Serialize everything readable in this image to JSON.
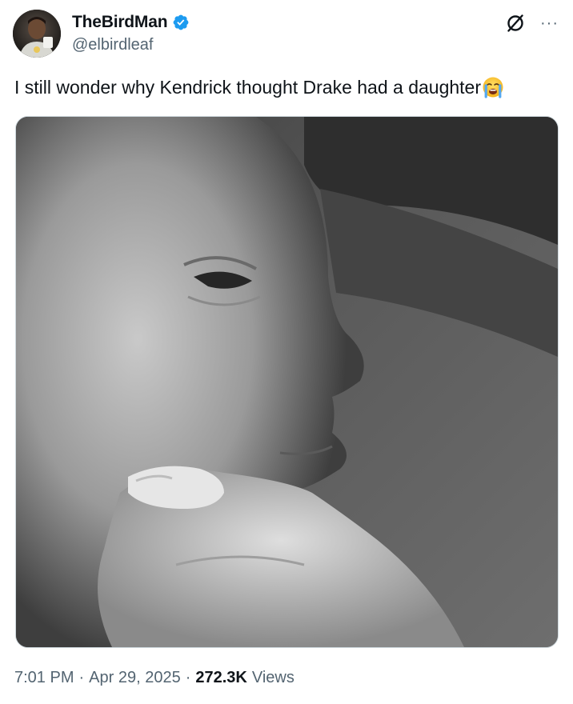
{
  "author": {
    "display_name": "TheBirdMan",
    "handle": "@elbirdleaf",
    "verified": true,
    "verified_color": "#1d9bf0"
  },
  "header_actions": {
    "grok_icon": "grok-icon",
    "more_icon": "more-icon",
    "more_label": "···"
  },
  "tweet": {
    "text": "I still wonder why Kendrick thought Drake had a daughter",
    "emoji": "loudly-crying-face"
  },
  "media": {
    "type": "photo",
    "style": "black-and-white"
  },
  "meta": {
    "time": "7:01 PM",
    "separator": "·",
    "date": "Apr 29, 2025",
    "views_count": "272.3K",
    "views_label": "Views"
  }
}
